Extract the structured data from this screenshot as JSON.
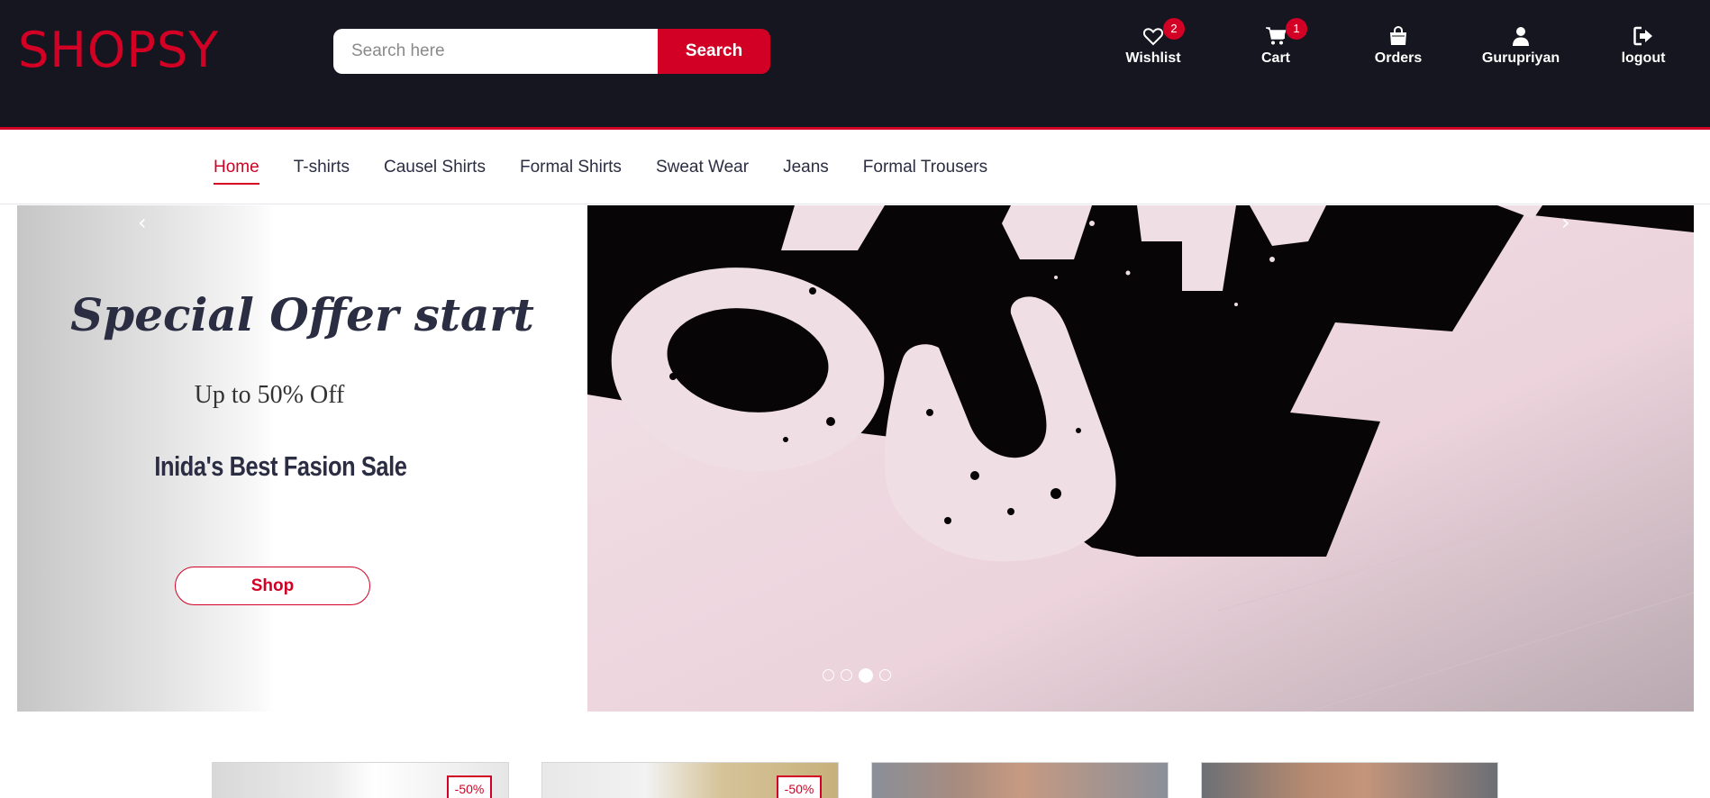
{
  "header": {
    "logo": "SHOPSY",
    "search": {
      "placeholder": "Search here",
      "button_label": "Search"
    },
    "actions": [
      {
        "label": "Wishlist",
        "icon": "heart-icon",
        "badge": "2"
      },
      {
        "label": "Cart",
        "icon": "cart-icon",
        "badge": "1"
      },
      {
        "label": "Orders",
        "icon": "shopping-bag-icon"
      },
      {
        "label": "Gurupriyan",
        "icon": "user-icon"
      },
      {
        "label": "logout",
        "icon": "logout-icon"
      }
    ]
  },
  "nav": {
    "items": [
      "Home",
      "T-shirts",
      "Causel Shirts",
      "Formal Shirts",
      "Sweat Wear",
      "Jeans",
      "Formal Trousers"
    ],
    "active": "Home"
  },
  "hero": {
    "title": "Special Offer start",
    "subtitle": "Up to 50% Off",
    "tagline": "Inida's Best Fasion Sale",
    "button_label": "Shop",
    "prev_arrow": "‹",
    "next_arrow": "›",
    "slides_count": 4,
    "active_slide": 3
  },
  "products": {
    "sale_badges": [
      "-50%",
      "-50%"
    ]
  },
  "colors": {
    "header_bg": "#15161f",
    "accent": "#d10024",
    "text_dark": "#2b2d42"
  }
}
